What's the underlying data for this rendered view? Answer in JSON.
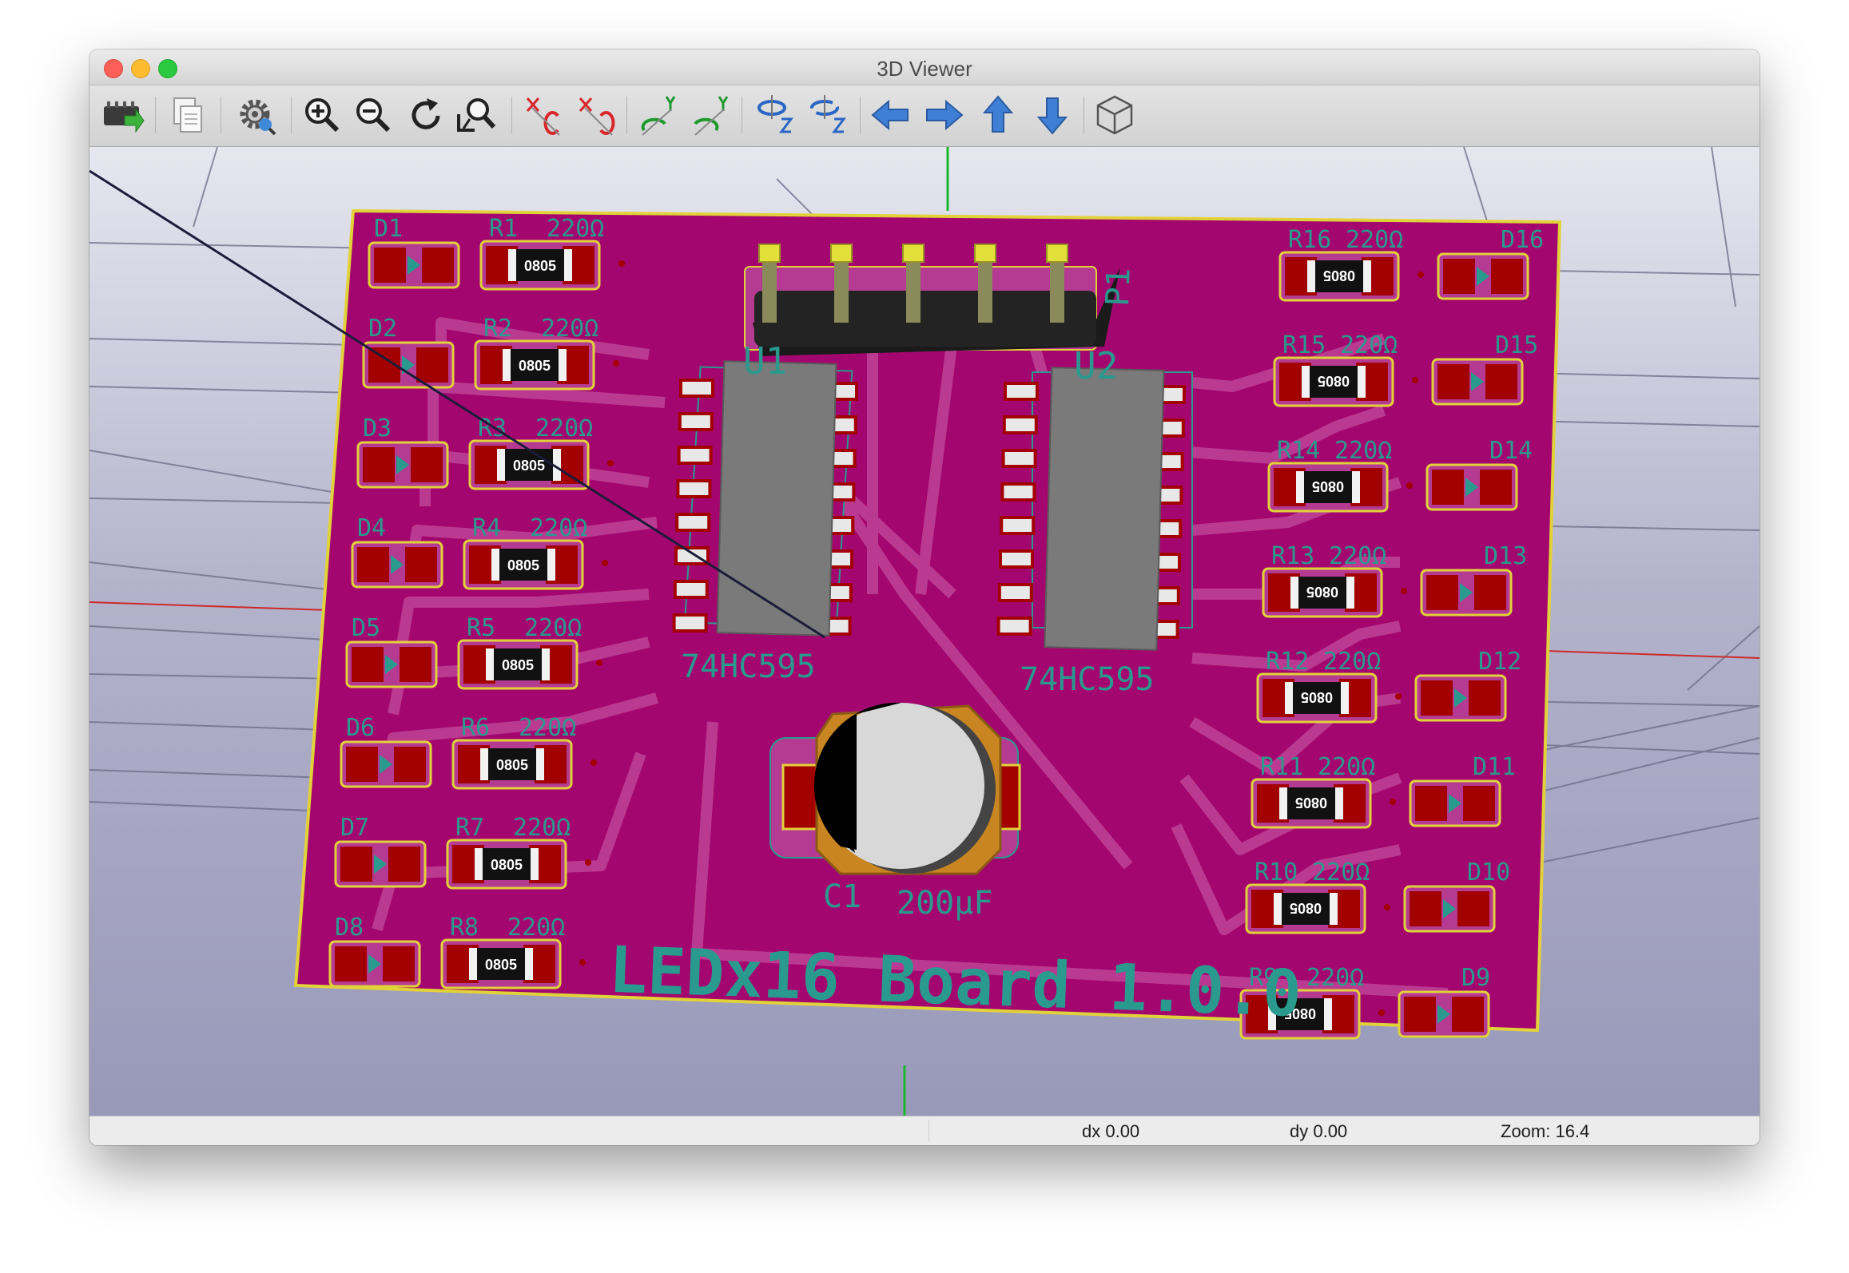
{
  "window": {
    "title": "3D Viewer"
  },
  "toolbar": {
    "icons": [
      "reload-board-icon",
      "copy-to-clipboard-icon",
      "settings-icon",
      "zoom-in-icon",
      "zoom-out-icon",
      "redraw-icon",
      "zoom-to-fit-icon",
      "rotate-x-cw-icon",
      "rotate-x-ccw-icon",
      "rotate-y-cw-icon",
      "rotate-y-ccw-icon",
      "rotate-z-cw-icon",
      "rotate-z-ccw-icon",
      "move-left-icon",
      "move-right-icon",
      "move-up-icon",
      "move-down-icon",
      "ortho-view-icon"
    ],
    "axis_x": "X",
    "axis_y": "Y",
    "axis_z": "Z"
  },
  "board": {
    "title": "LEDx16 Board 1.0.0",
    "connector": "P1",
    "ics": [
      {
        "ref": "U1",
        "value": "74HC595"
      },
      {
        "ref": "U2",
        "value": "74HC595"
      }
    ],
    "capacitor": {
      "ref": "C1",
      "value": "200µF"
    },
    "package_label": "0805",
    "left_column": [
      {
        "led": "D1",
        "resistor": "R1",
        "value": "220Ω"
      },
      {
        "led": "D2",
        "resistor": "R2",
        "value": "220Ω"
      },
      {
        "led": "D3",
        "resistor": "R3",
        "value": "220Ω"
      },
      {
        "led": "D4",
        "resistor": "R4",
        "value": "220Ω"
      },
      {
        "led": "D5",
        "resistor": "R5",
        "value": "220Ω"
      },
      {
        "led": "D6",
        "resistor": "R6",
        "value": "220Ω"
      },
      {
        "led": "D7",
        "resistor": "R7",
        "value": "220Ω"
      },
      {
        "led": "D8",
        "resistor": "R8",
        "value": "220Ω"
      }
    ],
    "right_column": [
      {
        "led": "D16",
        "resistor": "R16",
        "value": "220Ω"
      },
      {
        "led": "D15",
        "resistor": "R15",
        "value": "220Ω"
      },
      {
        "led": "D14",
        "resistor": "R14",
        "value": "220Ω"
      },
      {
        "led": "D13",
        "resistor": "R13",
        "value": "220Ω"
      },
      {
        "led": "D12",
        "resistor": "R12",
        "value": "220Ω"
      },
      {
        "led": "D11",
        "resistor": "R11",
        "value": "220Ω"
      },
      {
        "led": "D10",
        "resistor": "R10",
        "value": "220Ω"
      },
      {
        "led": "D9",
        "resistor": "R9",
        "value": "220Ω"
      }
    ],
    "colors": {
      "board": "#a3076f",
      "edge": "#e2d23a",
      "pad": "#a30000",
      "silkscreen": "#2a9a8f",
      "ic_body": "#7a7a7a"
    }
  },
  "status": {
    "dx": "dx 0.00",
    "dy": "dy 0.00",
    "zoom": "Zoom: 16.4"
  }
}
